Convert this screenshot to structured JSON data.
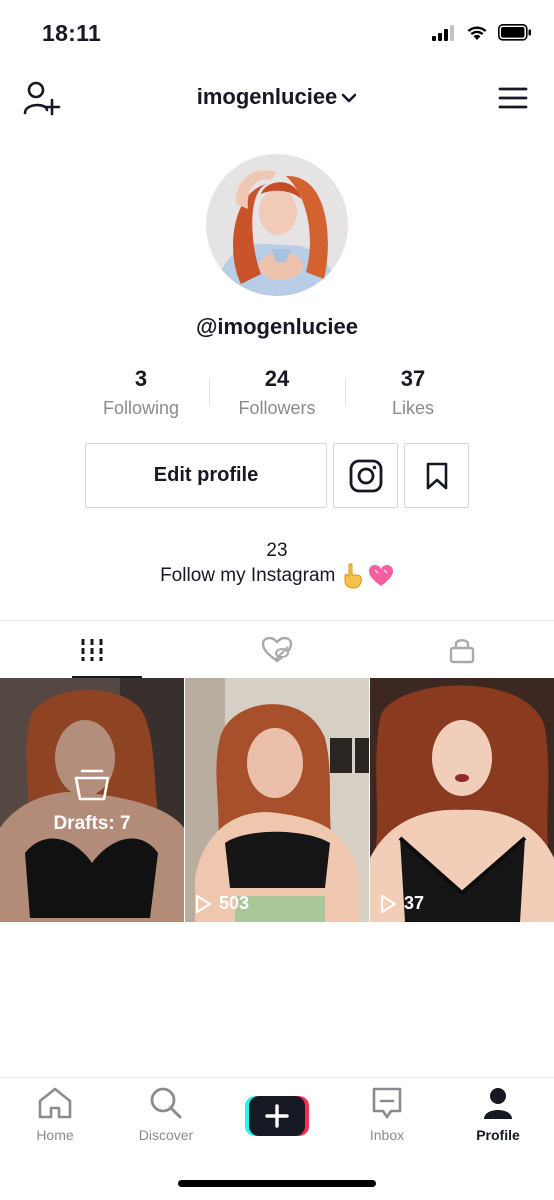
{
  "status_bar": {
    "time": "18:11"
  },
  "header": {
    "username": "imogenluciee"
  },
  "profile": {
    "handle": "@imogenluciee",
    "stats": [
      {
        "value": "3",
        "label": "Following"
      },
      {
        "value": "24",
        "label": "Followers"
      },
      {
        "value": "37",
        "label": "Likes"
      }
    ],
    "edit_profile_label": "Edit profile",
    "bio": {
      "count": "23",
      "text": "Follow my Instagram"
    }
  },
  "videos": [
    {
      "type": "drafts",
      "label": "Drafts: 7"
    },
    {
      "type": "video",
      "views": "503"
    },
    {
      "type": "video",
      "views": "37"
    }
  ],
  "bottom_nav": [
    {
      "label": "Home",
      "icon": "home-icon"
    },
    {
      "label": "Discover",
      "icon": "search-icon"
    },
    {
      "label": "",
      "icon": "plus-icon"
    },
    {
      "label": "Inbox",
      "icon": "inbox-icon"
    },
    {
      "label": "Profile",
      "icon": "profile-icon",
      "active": true
    }
  ],
  "colors": {
    "text": "#161823",
    "muted": "#8a8b91",
    "border": "#d7d8da",
    "accent_cyan": "#25f4ee",
    "accent_pink": "#fe2c55"
  }
}
